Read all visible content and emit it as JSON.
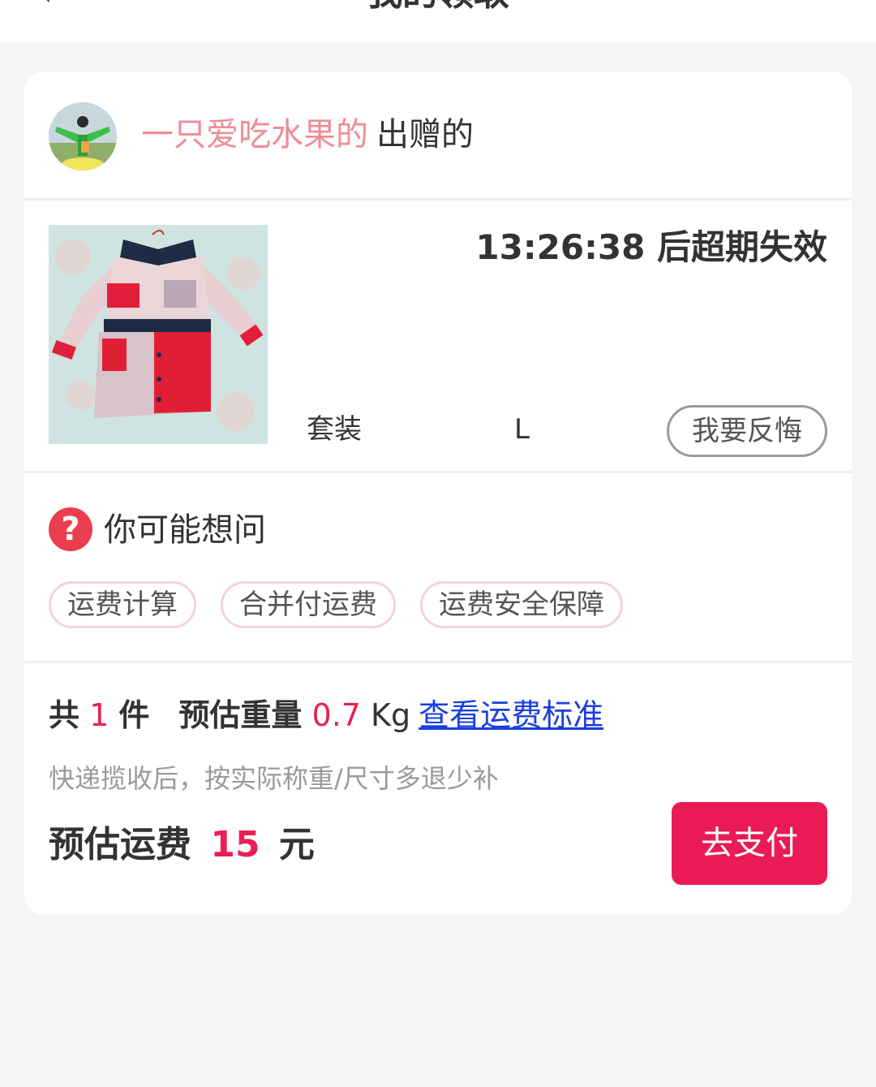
{
  "header": {
    "back_icon": "chevron-left-icon",
    "title": "我的领取"
  },
  "giver": {
    "name": "一只爱吃水果的",
    "suffix": "出赠的",
    "name_color": "#f08c97"
  },
  "product": {
    "countdown_time": "13:26:38",
    "countdown_suffix": "后超期失效",
    "name": "套装",
    "size": "L",
    "regret_label": "我要反悔"
  },
  "faq": {
    "icon": "question-icon",
    "title": "你可能想问",
    "tags": [
      "运费计算",
      "合并付运费",
      "运费安全保障"
    ]
  },
  "summary": {
    "count_prefix": "共",
    "count": "1",
    "count_unit": "件",
    "weight_label": "预估重量",
    "weight": "0.7",
    "weight_unit": "Kg",
    "link": "查看运费标准",
    "note": "快递揽收后，按实际称重/尺寸多退少补",
    "fee_label": "预估运费",
    "fee": "15",
    "fee_unit": "元",
    "pay_label": "去支付"
  },
  "colors": {
    "accent": "#ea1a55",
    "price": "#e91f56",
    "link": "#1a3fe0",
    "background": "#f5f5f5"
  }
}
